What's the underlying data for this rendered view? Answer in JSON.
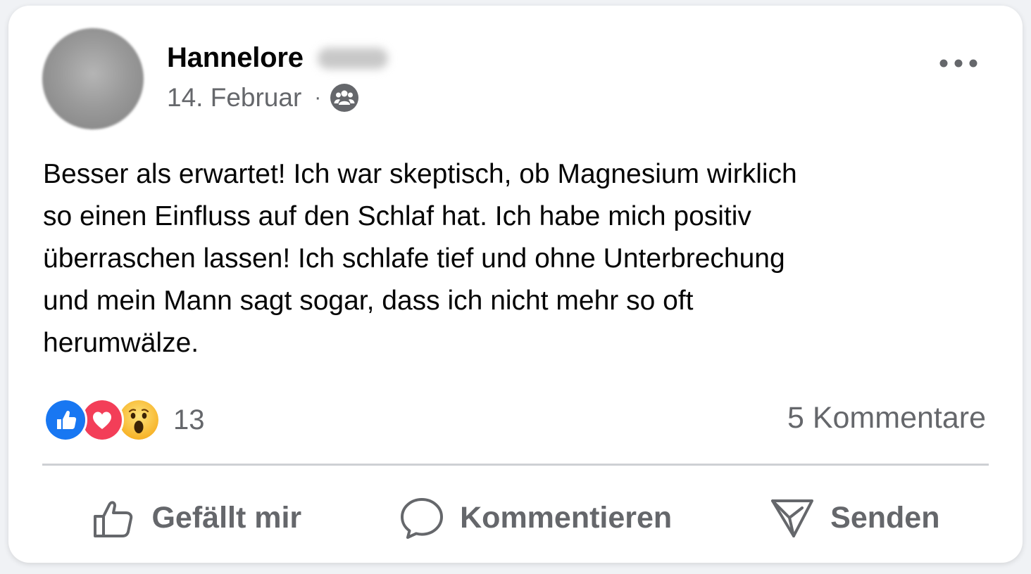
{
  "post": {
    "author_name": "Hannelore",
    "date": "14. Februar",
    "separator": "·",
    "audience_icon": "group-icon",
    "more_icon": "more-dots-icon",
    "text_lines": [
      "Besser als erwartet! Ich war skeptisch, ob Magnesium wirklich",
      "so einen Einfluss auf den Schlaf hat. Ich habe mich positiv",
      "überraschen lassen! Ich schlafe tief und ohne Unterbrechung",
      "und mein Mann sagt sogar, dass ich nicht mehr so oft",
      "herumwälze."
    ]
  },
  "reactions": {
    "icons": [
      "like-reaction-icon",
      "love-reaction-icon",
      "wow-reaction-icon"
    ],
    "count": "13",
    "comments": "5 Kommentare",
    "colors": {
      "like": "#1877f2",
      "love": "#f33e58",
      "wow": "#f7b125"
    }
  },
  "actions": {
    "like_label": "Gefällt mir",
    "comment_label": "Kommentieren",
    "send_label": "Senden"
  },
  "colors": {
    "text_primary": "#050505",
    "text_secondary": "#65676b",
    "divider": "#ced0d4"
  }
}
